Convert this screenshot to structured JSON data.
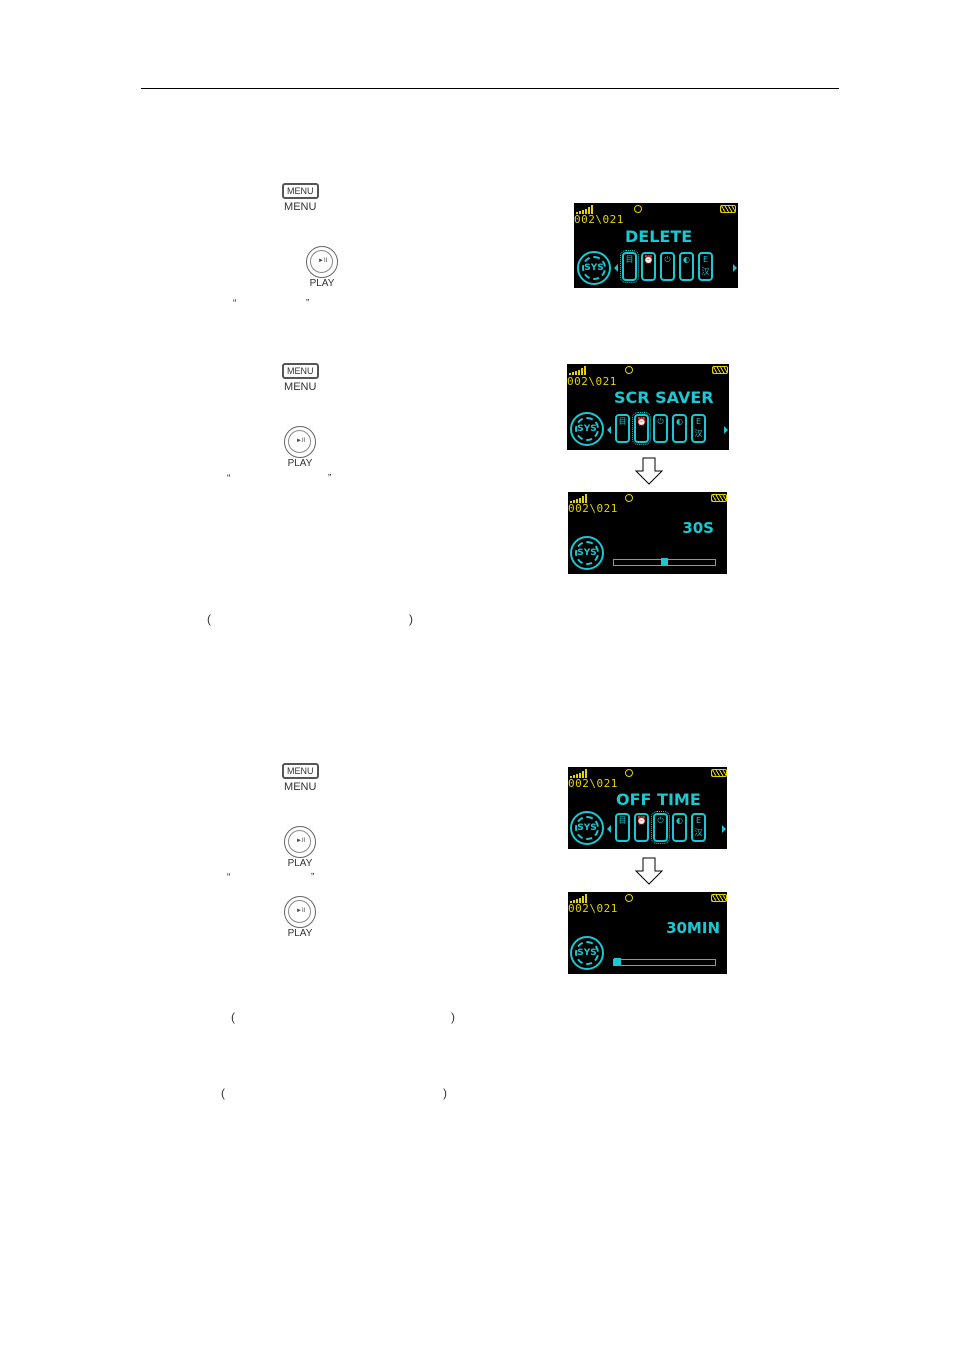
{
  "header": {
    "rule": true
  },
  "buttons": {
    "menu_key_text": "MENU",
    "menu_label": "MENU",
    "play_key_text": "►II",
    "play_label": "PLAY"
  },
  "punctuation": {
    "open_quote": "“",
    "close_quote": "”",
    "open_paren": "(",
    "close_paren": ")"
  },
  "screens": {
    "colors": {
      "accent": "#19c8d2",
      "status": "#e6d200",
      "background": "#000000"
    },
    "status_bar": {
      "track": "002\\021"
    },
    "sys_label": "SYS",
    "icon_glyphs": [
      "目",
      "⏰",
      "⏻",
      "◐",
      "E汉"
    ],
    "delete": {
      "title": "DELETE",
      "selected_icon": 1
    },
    "scr_saver": {
      "title": "SCR SAVER",
      "selected_icon": 2
    },
    "scr_saver_value": {
      "value": "30S",
      "slider_fraction": 0.5
    },
    "off_time": {
      "title": "OFF TIME",
      "selected_icon": 3
    },
    "off_time_value": {
      "value": "30MIN",
      "slider_fraction": 0.0
    }
  }
}
